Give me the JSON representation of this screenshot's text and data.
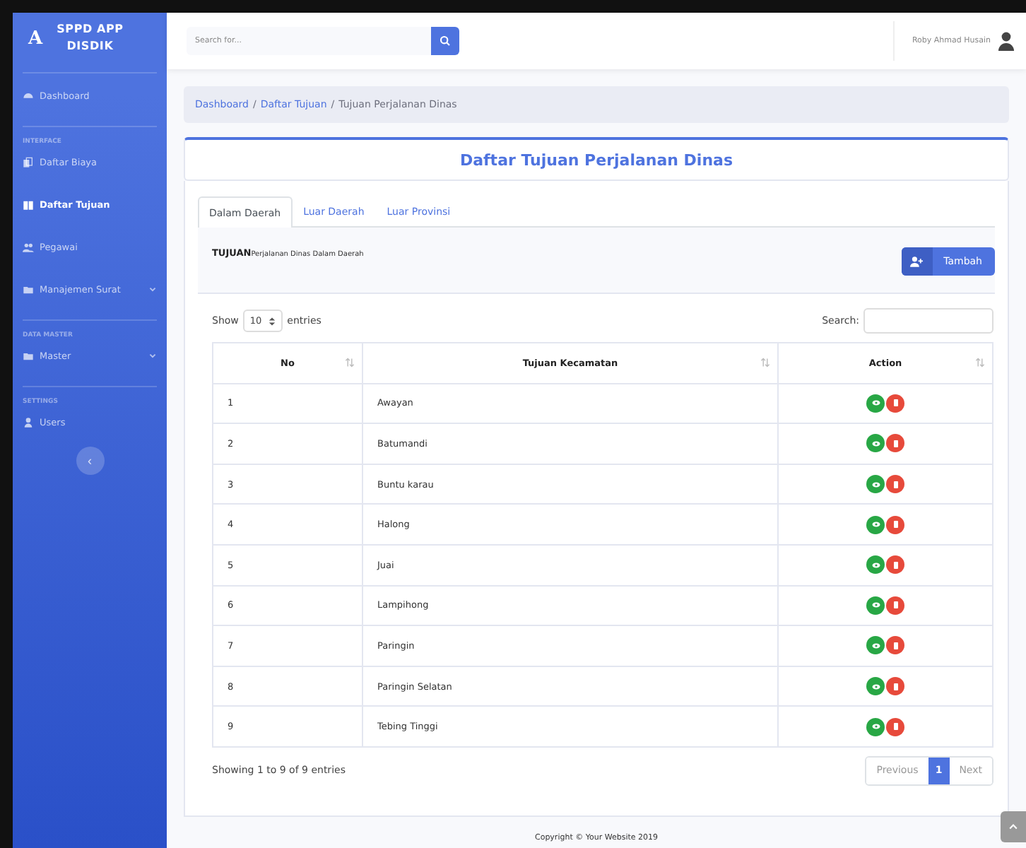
{
  "sidebar": {
    "brand": {
      "line1": "SPPD APP",
      "line2": "DISDIK",
      "logo": "A"
    },
    "sections": [
      {
        "items": [
          {
            "label": "Dashboard",
            "kind": "link",
            "selected": false
          }
        ]
      },
      {
        "heading": "INTERFACE",
        "items": [
          {
            "label": "Daftar Biaya",
            "kind": "link",
            "selected": false
          },
          {
            "label": "Daftar Tujuan",
            "kind": "link",
            "selected": true
          },
          {
            "label": "Pegawai",
            "kind": "link",
            "selected": false
          },
          {
            "label": "Manajemen Surat",
            "kind": "dropdown",
            "selected": false
          }
        ]
      },
      {
        "heading": "DATA MASTER",
        "items": [
          {
            "label": "Master",
            "kind": "dropdown",
            "selected": false
          }
        ]
      },
      {
        "heading": "SETTINGS",
        "items": [
          {
            "label": "Users",
            "kind": "link",
            "selected": false
          }
        ]
      }
    ],
    "toggle": "‹"
  },
  "topbar": {
    "search": {
      "placeholder": "Search for..."
    },
    "user": "Roby Ahmad Husain"
  },
  "breadcrumb": [
    {
      "label": "Dashboard",
      "kind": "link"
    },
    {
      "label": "/",
      "kind": "separator"
    },
    {
      "label": "Daftar Tujuan",
      "kind": "link"
    },
    {
      "label": "/",
      "kind": "separator"
    },
    {
      "label": "Tujuan Perjalanan Dinas",
      "kind": "current"
    }
  ],
  "card": {
    "title": "Daftar Tujuan Perjalanan Dinas",
    "tabs": [
      {
        "label": "Dalam Daerah",
        "selected": true
      },
      {
        "label": "Luar Daerah",
        "selected": false
      },
      {
        "label": "Luar Provinsi",
        "selected": false
      }
    ],
    "info": {
      "heading": "**TUJUAN**Perjalanan Dinas Dalam Daerah",
      "add_button": "Tambah"
    },
    "length": {
      "before": "Show",
      "value": "10",
      "after": "entries"
    },
    "search_label": "Search:",
    "table": {
      "columns": [
        "No",
        "Tujuan Kecamatan",
        "Action"
      ],
      "rows": [
        {
          "no": "1",
          "name": "Awayan"
        },
        {
          "no": "2",
          "name": "Batumandi"
        },
        {
          "no": "3",
          "name": "Buntu karau"
        },
        {
          "no": "4",
          "name": "Halong"
        },
        {
          "no": "5",
          "name": "Juai"
        },
        {
          "no": "6",
          "name": "Lampihong"
        },
        {
          "no": "7",
          "name": "Paringin"
        },
        {
          "no": "8",
          "name": "Paringin Selatan"
        },
        {
          "no": "9",
          "name": "Tebing Tinggi"
        }
      ]
    },
    "summary": "Showing 1 to 9 of 9 entries",
    "pagination": [
      {
        "label": "Previous",
        "kind": "nav",
        "selected": false
      },
      {
        "label": "1",
        "kind": "page",
        "selected": true
      },
      {
        "label": "Next",
        "kind": "nav",
        "selected": false
      }
    ]
  },
  "footer": "Copyright © Your Website 2019"
}
